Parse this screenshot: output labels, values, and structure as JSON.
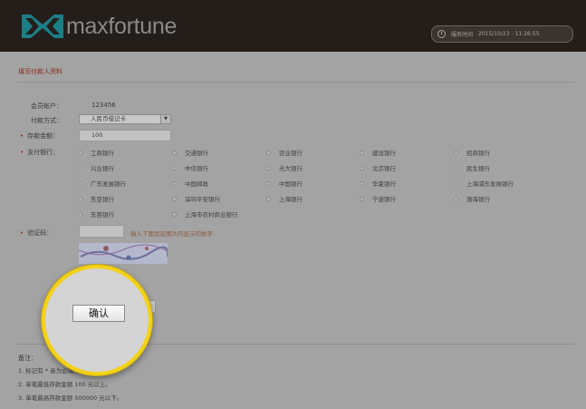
{
  "brand": {
    "name": "maxfortune"
  },
  "header": {
    "time_label": "服务时间",
    "time_value": "2015/10/23 - 11:26:55"
  },
  "form": {
    "section_title": "填写付款人资料",
    "account_label": "会员帐户：",
    "account_value": "123456",
    "payment_method_label": "付款方式：",
    "payment_method_value": "人民币借记卡",
    "amount_label": "存款金额：",
    "amount_value": "100",
    "bank_label": "支付银行：",
    "banks": [
      "工商银行",
      "交通银行",
      "农业银行",
      "建设银行",
      "招商银行",
      "兴业银行",
      "中信银行",
      "光大银行",
      "北京银行",
      "民生银行",
      "广东发展银行",
      "中国邮政",
      "中国银行",
      "华夏银行",
      "上海浦东发展银行",
      "东亚银行",
      "深圳平安银行",
      "上海银行",
      "宁波银行",
      "渤海银行",
      "东莞银行",
      "上海市农村商业银行"
    ],
    "captcha_label": "验证码：",
    "captcha_hint": "输入下面验证图片内显示的数字",
    "confirm_label": "确认"
  },
  "notes": {
    "title": "备注：",
    "items": [
      "1. 标记有 * 者为必填项目。",
      "2. 单笔最低存款金额 100 元以上。",
      "3. 单笔最高存款金额 500000 元以下。"
    ]
  },
  "colors": {
    "spotlight_ring": "#f2d219",
    "header_bg": "#241e1a",
    "required_mark": "#a82a1a"
  }
}
